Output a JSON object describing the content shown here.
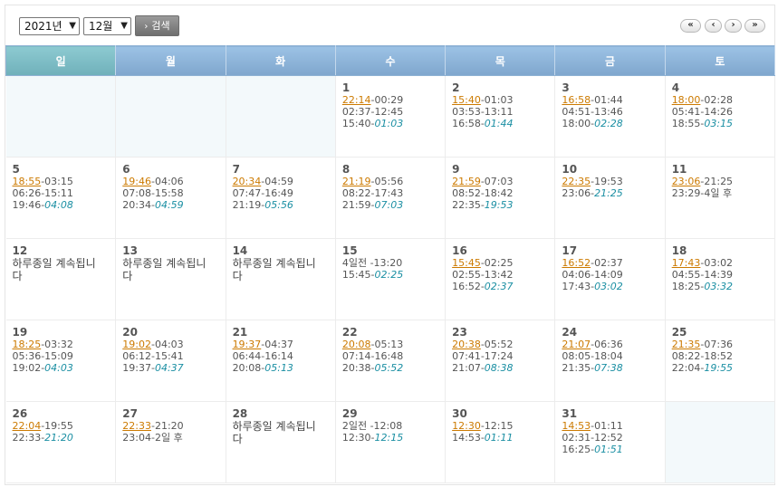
{
  "toolbar": {
    "year_select": "2021년",
    "month_select": "12월",
    "search_label": "검색",
    "nav": {
      "first": "«",
      "prev": "‹",
      "next": "›",
      "last": "»"
    }
  },
  "weekdays": [
    "일",
    "월",
    "화",
    "수",
    "목",
    "금",
    "토"
  ],
  "weeks": [
    [
      null,
      null,
      null,
      {
        "day": "1",
        "lines": [
          [
            "22:14",
            "-00:29",
            ""
          ],
          [
            "",
            "02:37-12:45",
            ""
          ],
          [
            "",
            "15:40-",
            "01:03"
          ]
        ]
      },
      {
        "day": "2",
        "lines": [
          [
            "15:40",
            "-01:03",
            ""
          ],
          [
            "",
            "03:53-13:11",
            ""
          ],
          [
            "",
            "16:58-",
            "01:44"
          ]
        ]
      },
      {
        "day": "3",
        "lines": [
          [
            "16:58",
            "-01:44",
            ""
          ],
          [
            "",
            "04:51-13:46",
            ""
          ],
          [
            "",
            "18:00-",
            "02:28"
          ]
        ]
      },
      {
        "day": "4",
        "lines": [
          [
            "18:00",
            "-02:28",
            ""
          ],
          [
            "",
            "05:41-14:26",
            ""
          ],
          [
            "",
            "18:55-",
            "03:15"
          ]
        ]
      }
    ],
    [
      {
        "day": "5",
        "lines": [
          [
            "18:55",
            "-03:15",
            ""
          ],
          [
            "",
            "06:26-15:11",
            ""
          ],
          [
            "",
            "19:46-",
            "04:08"
          ]
        ]
      },
      {
        "day": "6",
        "lines": [
          [
            "19:46",
            "-04:06",
            ""
          ],
          [
            "",
            "07:08-15:58",
            ""
          ],
          [
            "",
            "20:34-",
            "04:59"
          ]
        ]
      },
      {
        "day": "7",
        "lines": [
          [
            "20:34",
            "-04:59",
            ""
          ],
          [
            "",
            "07:47-16:49",
            ""
          ],
          [
            "",
            "21:19-",
            "05:56"
          ]
        ]
      },
      {
        "day": "8",
        "lines": [
          [
            "21:19",
            "-05:56",
            ""
          ],
          [
            "",
            "08:22-17:43",
            ""
          ],
          [
            "",
            "21:59-",
            "07:03"
          ]
        ]
      },
      {
        "day": "9",
        "lines": [
          [
            "21:59",
            "-07:03",
            ""
          ],
          [
            "",
            "08:52-18:42",
            ""
          ],
          [
            "",
            "22:35-",
            "19:53"
          ]
        ]
      },
      {
        "day": "10",
        "lines": [
          [
            "22:35",
            "-19:53",
            ""
          ],
          [
            "",
            "23:06-",
            "21:25"
          ]
        ]
      },
      {
        "day": "11",
        "lines": [
          [
            "23:06",
            "-21:25",
            ""
          ],
          [
            "",
            "23:29-4일 후",
            ""
          ]
        ]
      }
    ],
    [
      {
        "day": "12",
        "note": "하루종일 계속됩니다"
      },
      {
        "day": "13",
        "note": "하루종일 계속됩니다"
      },
      {
        "day": "14",
        "note": "하루종일 계속됩니다"
      },
      {
        "day": "15",
        "lines": [
          [
            "",
            "4일전 -13:20",
            ""
          ],
          [
            "",
            "15:45-",
            "02:25"
          ]
        ]
      },
      {
        "day": "16",
        "lines": [
          [
            "15:45",
            "-02:25",
            ""
          ],
          [
            "",
            "02:55-13:42",
            ""
          ],
          [
            "",
            "16:52-",
            "02:37"
          ]
        ]
      },
      {
        "day": "17",
        "lines": [
          [
            "16:52",
            "-02:37",
            ""
          ],
          [
            "",
            "04:06-14:09",
            ""
          ],
          [
            "",
            "17:43-",
            "03:02"
          ]
        ]
      },
      {
        "day": "18",
        "lines": [
          [
            "17:43",
            "-03:02",
            ""
          ],
          [
            "",
            "04:55-14:39",
            ""
          ],
          [
            "",
            "18:25-",
            "03:32"
          ]
        ]
      }
    ],
    [
      {
        "day": "19",
        "lines": [
          [
            "18:25",
            "-03:32",
            ""
          ],
          [
            "",
            "05:36-15:09",
            ""
          ],
          [
            "",
            "19:02-",
            "04:03"
          ]
        ]
      },
      {
        "day": "20",
        "lines": [
          [
            "19:02",
            "-04:03",
            ""
          ],
          [
            "",
            "06:12-15:41",
            ""
          ],
          [
            "",
            "19:37-",
            "04:37"
          ]
        ]
      },
      {
        "day": "21",
        "lines": [
          [
            "19:37",
            "-04:37",
            ""
          ],
          [
            "",
            "06:44-16:14",
            ""
          ],
          [
            "",
            "20:08-",
            "05:13"
          ]
        ]
      },
      {
        "day": "22",
        "lines": [
          [
            "20:08",
            "-05:13",
            ""
          ],
          [
            "",
            "07:14-16:48",
            ""
          ],
          [
            "",
            "20:38-",
            "05:52"
          ]
        ]
      },
      {
        "day": "23",
        "lines": [
          [
            "20:38",
            "-05:52",
            ""
          ],
          [
            "",
            "07:41-17:24",
            ""
          ],
          [
            "",
            "21:07-",
            "08:38"
          ]
        ]
      },
      {
        "day": "24",
        "lines": [
          [
            "21:07",
            "-06:36",
            ""
          ],
          [
            "",
            "08:05-18:04",
            ""
          ],
          [
            "",
            "21:35-",
            "07:38"
          ]
        ]
      },
      {
        "day": "25",
        "lines": [
          [
            "21:35",
            "-07:36",
            ""
          ],
          [
            "",
            "08:22-18:52",
            ""
          ],
          [
            "",
            "22:04-",
            "19:55"
          ]
        ]
      }
    ],
    [
      {
        "day": "26",
        "lines": [
          [
            "22:04",
            "-19:55",
            ""
          ],
          [
            "",
            "22:33-",
            "21:20"
          ]
        ]
      },
      {
        "day": "27",
        "lines": [
          [
            "22:33",
            "-21:20",
            ""
          ],
          [
            "",
            "23:04-2일 후",
            ""
          ]
        ]
      },
      {
        "day": "28",
        "note": "하루종일 계속됩니다"
      },
      {
        "day": "29",
        "lines": [
          [
            "",
            "2일전 -12:08",
            ""
          ],
          [
            "",
            "12:30-",
            "12:15"
          ]
        ]
      },
      {
        "day": "30",
        "lines": [
          [
            "12:30",
            "-12:15",
            ""
          ],
          [
            "",
            "14:53-",
            "01:11"
          ]
        ]
      },
      {
        "day": "31",
        "lines": [
          [
            "14:53",
            "-01:11",
            ""
          ],
          [
            "",
            "02:31-12:52",
            ""
          ],
          [
            "",
            "16:25-",
            "01:51"
          ]
        ]
      },
      null
    ]
  ],
  "colors": {
    "header": "#8fb5da",
    "rise_link": "#cc7a00",
    "duration": "#1b8fa3",
    "empty_cell": "#f3f9fb"
  }
}
